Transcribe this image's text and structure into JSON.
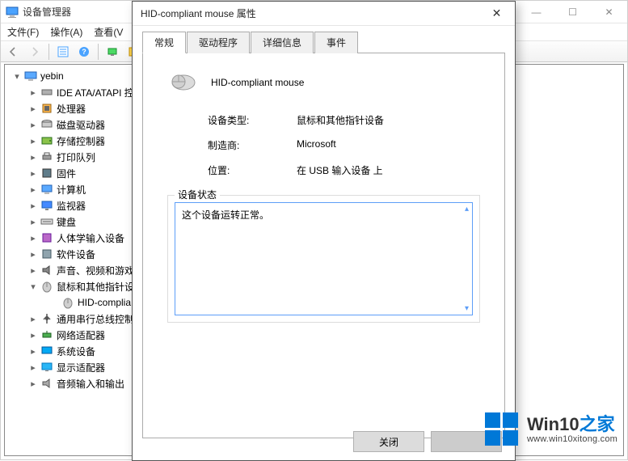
{
  "dm": {
    "title": "设备管理器",
    "menubar": {
      "file": "文件(F)",
      "action": "操作(A)",
      "view": "查看(V"
    },
    "winctrls": {
      "min": "—",
      "max": "☐",
      "close": "✕"
    },
    "tree": {
      "root": {
        "label": "yebin",
        "expand": "▾"
      },
      "items": [
        {
          "label": "IDE ATA/ATAPI 控",
          "expand": "▸",
          "icon": "ide"
        },
        {
          "label": "处理器",
          "expand": "▸",
          "icon": "cpu"
        },
        {
          "label": "磁盘驱动器",
          "expand": "▸",
          "icon": "disk"
        },
        {
          "label": "存储控制器",
          "expand": "▸",
          "icon": "storage"
        },
        {
          "label": "打印队列",
          "expand": "▸",
          "icon": "printer"
        },
        {
          "label": "固件",
          "expand": "▸",
          "icon": "firmware"
        },
        {
          "label": "计算机",
          "expand": "▸",
          "icon": "computer"
        },
        {
          "label": "监视器",
          "expand": "▸",
          "icon": "monitor"
        },
        {
          "label": "键盘",
          "expand": "▸",
          "icon": "keyboard"
        },
        {
          "label": "人体学输入设备",
          "expand": "▸",
          "icon": "hid"
        },
        {
          "label": "软件设备",
          "expand": "▸",
          "icon": "software"
        },
        {
          "label": "声音、视频和游戏",
          "expand": "▸",
          "icon": "audio"
        },
        {
          "label": "鼠标和其他指针设",
          "expand": "▾",
          "icon": "mouse"
        },
        {
          "label": "HID-complia",
          "expand": "",
          "icon": "mouse",
          "child": true
        },
        {
          "label": "通用串行总线控制",
          "expand": "▸",
          "icon": "usb"
        },
        {
          "label": "网络适配器",
          "expand": "▸",
          "icon": "network"
        },
        {
          "label": "系统设备",
          "expand": "▸",
          "icon": "system"
        },
        {
          "label": "显示适配器",
          "expand": "▸",
          "icon": "display"
        },
        {
          "label": "音频输入和输出",
          "expand": "▸",
          "icon": "audioio"
        }
      ]
    }
  },
  "props": {
    "title": "HID-compliant mouse 属性",
    "close_glyph": "✕",
    "tabs": {
      "general": "常规",
      "driver": "驱动程序",
      "details": "详细信息",
      "events": "事件"
    },
    "device_name": "HID-compliant mouse",
    "labels": {
      "type": "设备类型:",
      "mfr": "制造商:",
      "loc": "位置:"
    },
    "values": {
      "type": "鼠标和其他指针设备",
      "mfr": "Microsoft",
      "loc": "在 USB 输入设备 上"
    },
    "statusbox_label": "设备状态",
    "status_text": "这个设备运转正常。",
    "buttons": {
      "close": "关闭"
    }
  },
  "watermark": {
    "brand_prefix": "Win10",
    "brand_suffix": "之家",
    "url": "www.win10xitong.com"
  }
}
